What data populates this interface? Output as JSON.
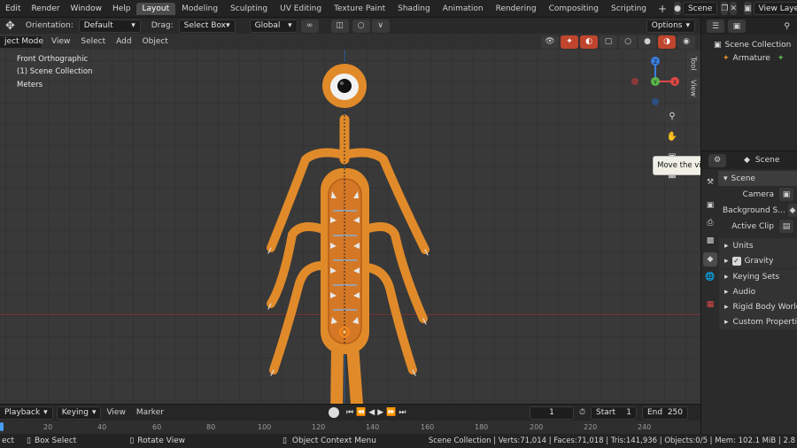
{
  "menubar": {
    "menus": [
      "Edit",
      "Render",
      "Window",
      "Help"
    ],
    "workspaces": [
      "Layout",
      "Modeling",
      "Sculpting",
      "UV Editing",
      "Texture Paint",
      "Shading",
      "Animation",
      "Rendering",
      "Compositing",
      "Scripting"
    ],
    "active_workspace": "Layout",
    "add_tab": "+",
    "scene_name": "Scene",
    "view_layer": "View Layer"
  },
  "tool_header": {
    "orientation_label": "Orientation:",
    "orientation_value": "Default",
    "drag_label": "Drag:",
    "drag_value": "Select Box",
    "transform_value": "Global",
    "options_label": "Options"
  },
  "viewport_header": {
    "mode": "ject Mode",
    "menus": [
      "View",
      "Select",
      "Add",
      "Object"
    ]
  },
  "viewport": {
    "view_name": "Front Orthographic",
    "collection": "(1) Scene Collection",
    "units": "Meters",
    "gizmo_axes": [
      "Z",
      "Y",
      "X"
    ],
    "tooltip": "Move the view",
    "side_tabs": [
      "Tool",
      "View"
    ],
    "icons": [
      "zoom-icon",
      "hand-icon",
      "camera-icon",
      "grid-icon"
    ]
  },
  "outliner": {
    "items": [
      {
        "label": "Scene Collection"
      },
      {
        "label": "Armature"
      }
    ]
  },
  "properties": {
    "header_scene": "Scene",
    "section": "Scene",
    "camera_label": "Camera",
    "background_label": "Background S...",
    "active_clip_label": "Active Clip",
    "panels": [
      "Units",
      "Gravity",
      "Keying Sets",
      "Audio",
      "Rigid Body World",
      "Custom Properties"
    ],
    "gravity_checked": true
  },
  "timeline": {
    "menus": [
      "Playback",
      "Keying",
      "View",
      "Marker"
    ],
    "current_frame": "1",
    "start_label": "Start",
    "start_value": "1",
    "end_label": "End",
    "end_value": "250",
    "ticks": [
      "20",
      "40",
      "60",
      "80",
      "100",
      "120",
      "140",
      "160",
      "180",
      "200",
      "220",
      "240"
    ]
  },
  "statusbar": {
    "left_1": "ect",
    "box_select": "Box Select",
    "rotate_view": "Rotate View",
    "context_menu": "Object Context Menu",
    "stats": "Scene Collection | Verts:71,014 | Faces:71,018 | Tris:141,936 | Objects:0/5 | Mem: 102.1 MiB | 2.8"
  },
  "colors": {
    "creature_orange": "#e08a2a",
    "axis_x": "#e04848",
    "axis_y": "#5ab84a",
    "axis_z": "#3a7ee0"
  }
}
